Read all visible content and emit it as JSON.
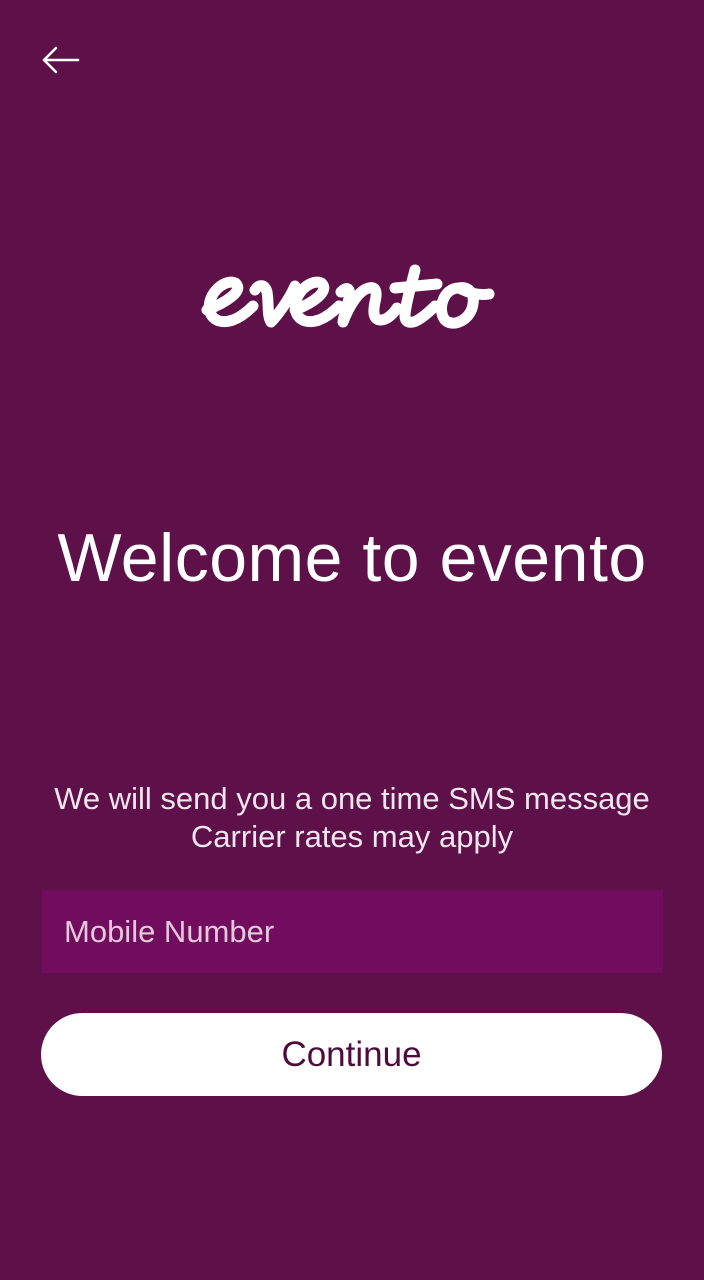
{
  "header": {
    "back_icon": "arrow-left-icon"
  },
  "logo": {
    "text": "evento"
  },
  "welcome": {
    "title": "Welcome to evento"
  },
  "info": {
    "line1": "We will send you a one time SMS message",
    "line2": "Carrier rates may apply"
  },
  "form": {
    "mobile_value": "",
    "mobile_placeholder": "Mobile Number",
    "continue_label": "Continue"
  },
  "colors": {
    "background": "#5e1049",
    "input_background": "#720c5e",
    "button_background": "#ffffff",
    "button_text": "#4e0c3c"
  }
}
